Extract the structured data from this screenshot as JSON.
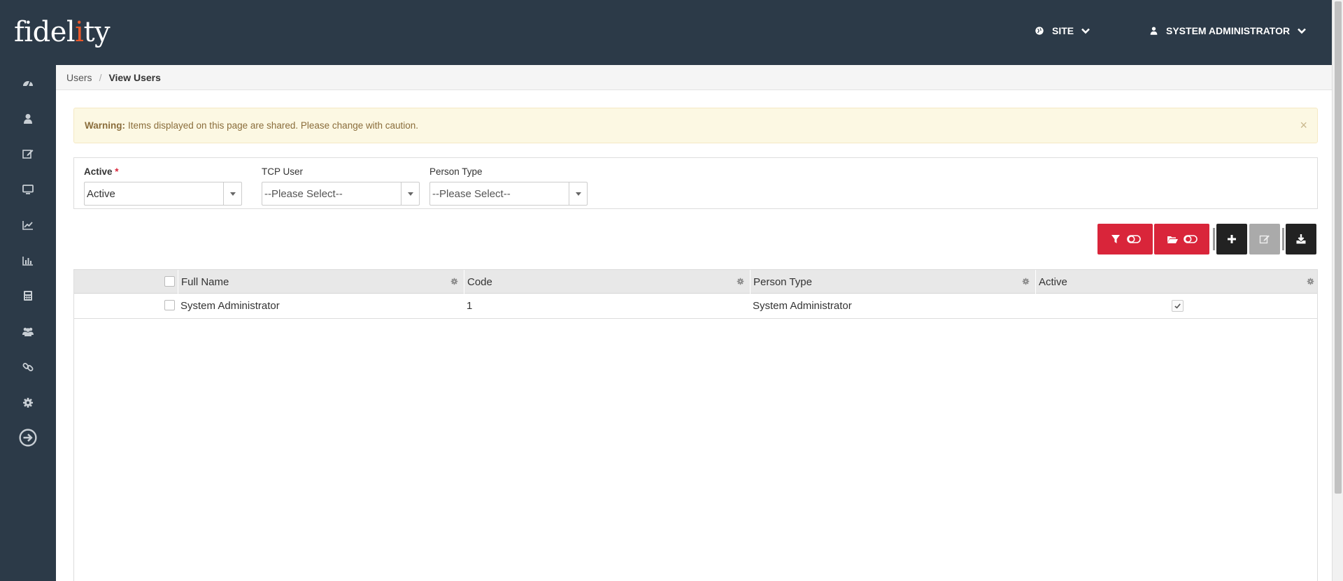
{
  "app": {
    "logo_text_a": "fidel",
    "logo_text_accent": "i",
    "logo_text_b": "ty"
  },
  "topbar": {
    "site_label": "SITE",
    "user_label": "SYSTEM ADMINISTRATOR"
  },
  "sidebar": {
    "items": [
      {
        "icon": "dashboard-icon"
      },
      {
        "icon": "user-icon"
      },
      {
        "icon": "edit-icon"
      },
      {
        "icon": "monitor-icon"
      },
      {
        "icon": "line-chart-icon"
      },
      {
        "icon": "bar-chart-icon"
      },
      {
        "icon": "calculator-icon"
      },
      {
        "icon": "users-group-icon"
      },
      {
        "icon": "link-icon"
      },
      {
        "icon": "gear-icon"
      },
      {
        "icon": "logout-icon"
      }
    ]
  },
  "breadcrumb": {
    "parent": "Users",
    "separator": "/",
    "current": "View Users"
  },
  "alert": {
    "strong": "Warning:",
    "message": "Items displayed on this page are shared. Please change with caution.",
    "close": "×"
  },
  "filters": {
    "active": {
      "label": "Active",
      "required_mark": "*",
      "value": "Active"
    },
    "tcp_user": {
      "label": "TCP User",
      "value": "--Please Select--"
    },
    "person_type": {
      "label": "Person Type",
      "value": "--Please Select--"
    }
  },
  "table": {
    "columns": [
      "Full Name",
      "Code",
      "Person Type",
      "Active"
    ],
    "rows": [
      {
        "full_name": "System Administrator",
        "code": "1",
        "person_type": "System Administrator",
        "active": true
      }
    ]
  },
  "colors": {
    "header_bg": "#2c3a48",
    "accent_red": "#d9253a",
    "logo_accent": "#e8572a",
    "alert_bg": "#fcf8e3"
  }
}
